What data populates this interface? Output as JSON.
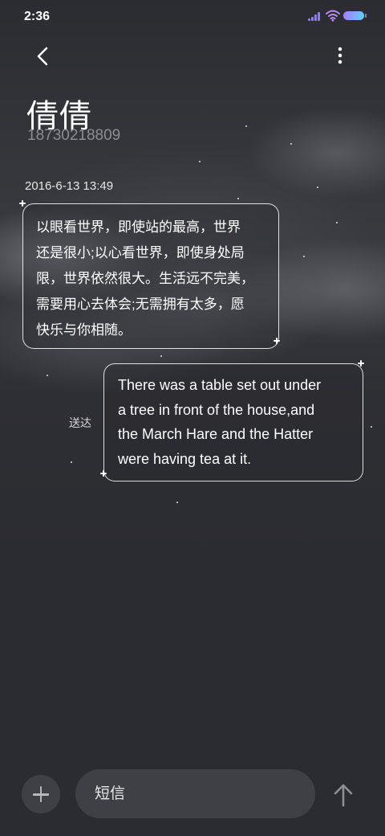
{
  "status_bar": {
    "time": "2:36",
    "signal_icon": "signal-icon",
    "wifi_icon": "wifi-icon",
    "battery_icon": "battery-icon"
  },
  "header": {
    "back_icon": "chevron-left-icon",
    "more_icon": "more-vertical-icon",
    "contact_name": "倩倩",
    "contact_number": "18730218809"
  },
  "conversation": {
    "date": "2016-6-13 13:49",
    "messages": [
      {
        "direction": "incoming",
        "text": "以眼看世界，即使站的最高，世界\n还是很小;以心看世界，即使身处局\n限，世界依然很大。生活远不完美，\n需要用心去体会;无需拥有太多，愿\n快乐与你相随。"
      },
      {
        "direction": "outgoing",
        "text": "There was a table set out under\na tree in front of the house,and\nthe March Hare and the Hatter\nwere having tea at it.",
        "status": "送达"
      }
    ]
  },
  "composer": {
    "add_icon": "plus-icon",
    "placeholder": "短信",
    "send_icon": "arrow-up-icon"
  },
  "colors": {
    "background": "#2b2c31",
    "input_background": "#3f4045",
    "secondary_text": "#8c8d92",
    "battery_gradient_start": "#a77ef7",
    "battery_gradient_end": "#5fd0ff"
  }
}
